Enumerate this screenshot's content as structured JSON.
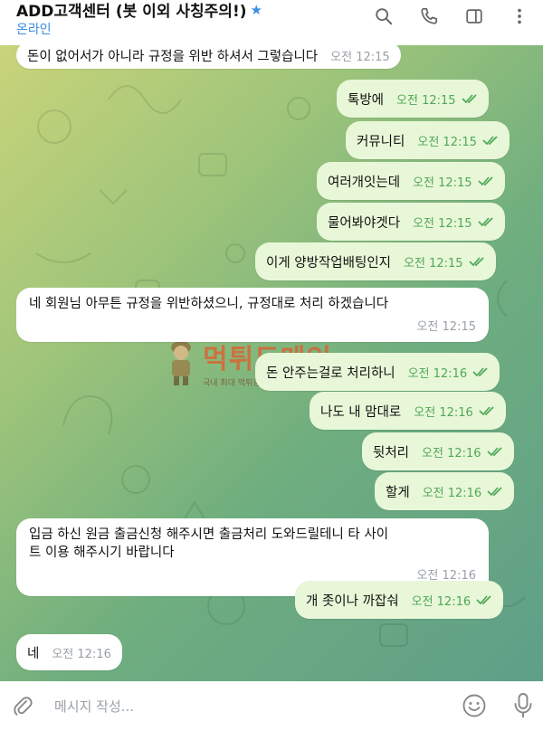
{
  "header": {
    "title": "ADD고객센터 (봇 이외 사칭주의!)",
    "star_icon": "verified-star-icon",
    "status": "온라인",
    "icons": [
      "search-icon",
      "phone-icon",
      "sidebar-panel-icon",
      "more-vertical-icon"
    ]
  },
  "messages": [
    {
      "dir": "in",
      "text": "돈이 없어서가 아니라 규정을 위반 하셔서 그렇습니다",
      "time": "오전 12:15"
    },
    {
      "dir": "out",
      "text": "톡방에",
      "time": "오전 12:15"
    },
    {
      "dir": "out",
      "text": "커뮤니티",
      "time": "오전 12:15"
    },
    {
      "dir": "out",
      "text": "여러개잇는데",
      "time": "오전 12:15"
    },
    {
      "dir": "out",
      "text": "물어봐야겟다",
      "time": "오전 12:15"
    },
    {
      "dir": "out",
      "text": "이게 양방작업배팅인지",
      "time": "오전 12:15"
    },
    {
      "dir": "in",
      "text": "네 회원님 아무튼 규정을 위반하셨으니, 규정대로 처리 하겠습니다",
      "time": "오전 12:15"
    },
    {
      "dir": "out",
      "text": "돈 안주는걸로 처리하니",
      "time": "오전 12:16"
    },
    {
      "dir": "out",
      "text": "나도 내 맘대로",
      "time": "오전 12:16"
    },
    {
      "dir": "out",
      "text": "뒷처리",
      "time": "오전 12:16"
    },
    {
      "dir": "out",
      "text": "할게",
      "time": "오전 12:16"
    },
    {
      "dir": "in",
      "text": "입금 하신 원금 출금신청 해주시면 출금처리 도와드릴테니 타 사이트 이용 해주시기 바랍니다",
      "time": "오전 12:16"
    },
    {
      "dir": "out",
      "text": "개 좃이나 까잡숴",
      "time": "오전 12:16"
    },
    {
      "dir": "in",
      "text": "네",
      "time": "오전 12:16"
    }
  ],
  "watermark": {
    "title": "먹튀도메인",
    "subtitle": "국내 최대 먹튀검증 커뮤니티 먹튀도메인"
  },
  "input": {
    "placeholder": "메시지 작성...",
    "icons": [
      "attach-paperclip-icon",
      "emoji-icon",
      "microphone-icon"
    ]
  },
  "colors": {
    "accent": "#3a8ee6",
    "outgoing_bubble": "#e8f7d7",
    "incoming_bubble": "#ffffff",
    "read_check": "#4fa85a"
  }
}
